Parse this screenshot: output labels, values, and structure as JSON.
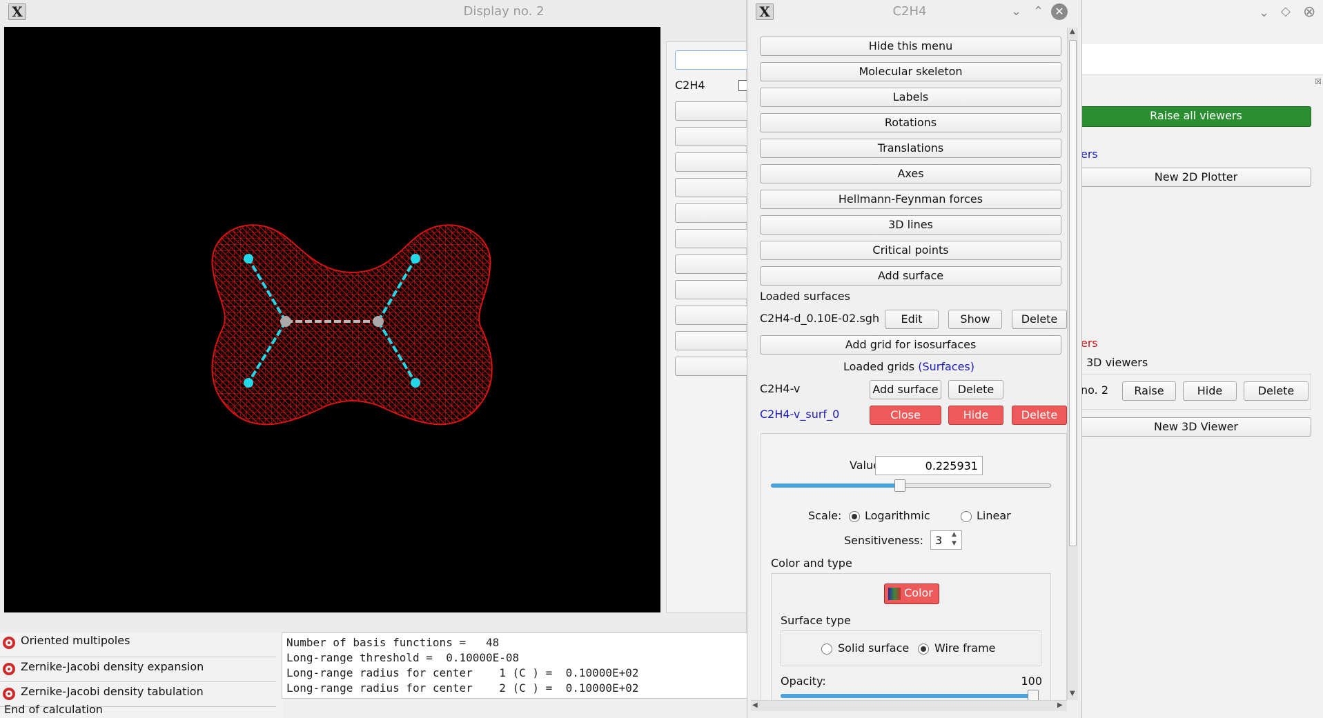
{
  "display_window": {
    "title": "Display no. 2",
    "side_label": "C2H4"
  },
  "right_panel": {
    "raise_all": "Raise all viewers",
    "section_2d_partial": "ers",
    "new_2d": "New 2D Plotter",
    "section_3d_partial": "ers",
    "viewers_3d_label": "3D viewers",
    "viewer_row_partial": "no. 2",
    "raise": "Raise",
    "hide": "Hide",
    "delete": "Delete",
    "new_3d": "New 3D Viewer"
  },
  "menu": {
    "title": "C2H4",
    "buttons": [
      "Hide this menu",
      "Molecular skeleton",
      "Labels",
      "Rotations",
      "Translations",
      "Axes",
      "Hellmann-Feynman forces",
      "3D lines",
      "Critical points",
      "Add surface"
    ],
    "loaded_surfaces_label": "Loaded surfaces",
    "surface_file": "C2H4-d_0.10E-02.sgh",
    "edit": "Edit",
    "show": "Show",
    "delete": "Delete",
    "add_grid": "Add grid for isosurfaces",
    "loaded_grids_label": "Loaded grids",
    "surfaces_link": "(Surfaces)",
    "grid_name": "C2H4-v",
    "add_surface": "Add surface",
    "grid_delete": "Delete",
    "surf_name": "C2H4-v_surf_0",
    "close": "Close",
    "hide": "Hide",
    "surf_delete": "Delete",
    "value_label": "Value:",
    "value": "0.225931",
    "value_slider_fraction": 0.46,
    "scale_label": "Scale:",
    "log": "Logarithmic",
    "linear": "Linear",
    "sens_label": "Sensitiveness:",
    "sens_value": "3",
    "color_type_label": "Color and type",
    "color_btn": "Color",
    "surface_type_label": "Surface type",
    "solid": "Solid surface",
    "wire": "Wire frame",
    "opacity_label": "Opacity:",
    "opacity_value": "100",
    "opacity_fraction": 1.0
  },
  "tasks": [
    "Oriented multipoles",
    "Zernike-Jacobi density expansion",
    "Zernike-Jacobi density tabulation"
  ],
  "status": "End of calculation",
  "log_lines": [
    "Number of basis functions =   48",
    "Long-range threshold =  0.10000E-08",
    "Long-range radius for center    1 (C ) =  0.10000E+02",
    "Long-range radius for center    2 (C ) =  0.10000E+02"
  ],
  "colors": {
    "surface": "#cc1010",
    "hydrogen": "#22d8e8",
    "carbon": "#aaaaaa",
    "accent_red": "#ee5a5a",
    "accent_green": "#2b8f32"
  }
}
